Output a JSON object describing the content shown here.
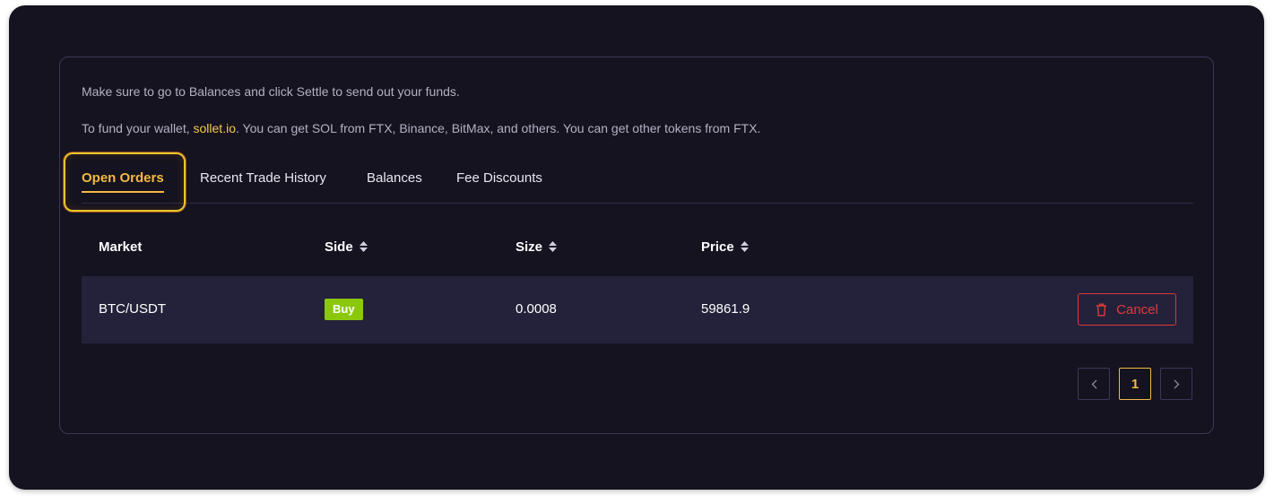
{
  "notices": {
    "line1": "Make sure to go to Balances and click Settle to send out your funds.",
    "line2_prefix": "To fund your wallet, ",
    "line2_link": "sollet.io",
    "line2_suffix": ". You can get SOL from FTX, Binance, BitMax, and others. You can get other tokens from FTX."
  },
  "tabs": [
    {
      "label": "Open Orders",
      "active": true
    },
    {
      "label": "Recent Trade History",
      "active": false
    },
    {
      "label": "Balances",
      "active": false
    },
    {
      "label": "Fee Discounts",
      "active": false
    }
  ],
  "table": {
    "columns": [
      "Market",
      "Side",
      "Size",
      "Price"
    ],
    "rows": [
      {
        "market": "BTC/USDT",
        "side": "Buy",
        "size": "0.0008",
        "price": "59861.9",
        "action": "Cancel"
      }
    ]
  },
  "pagination": {
    "prev_icon": "chevron-left-icon",
    "current_page": "1",
    "next_icon": "chevron-right-icon"
  },
  "colors": {
    "background": "#15131f",
    "accent": "#f2b944",
    "buy": "#8bc80c",
    "cancel": "#e0393c",
    "row": "#24223a"
  }
}
